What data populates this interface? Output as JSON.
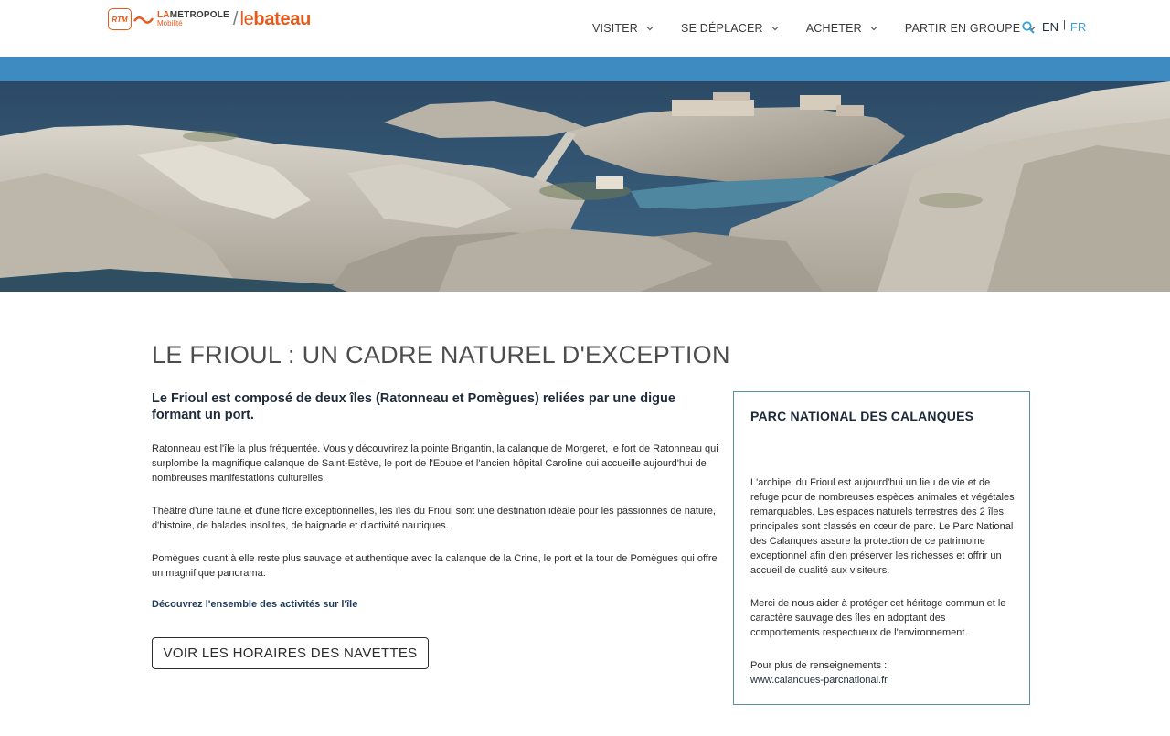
{
  "header": {
    "logo": {
      "rtm_badge": "RTM",
      "metropole_prefix": "LA",
      "metropole_name": "METROPOLE",
      "metropole_sub": "Mobilité",
      "brand_prefix": "le",
      "brand_name": "bateau"
    },
    "nav": [
      {
        "label": "VISITER",
        "icon": "chevron-down-icon"
      },
      {
        "label": "SE DÉPLACER",
        "icon": "chevron-down-icon"
      },
      {
        "label": "ACHETER",
        "icon": "chevron-down-icon"
      },
      {
        "label": "PARTIR EN GROUPE",
        "icon": "chevron-down-icon"
      }
    ],
    "search_icon": "search-icon",
    "lang": {
      "en": "EN",
      "fr": "FR",
      "active": "FR"
    }
  },
  "colors": {
    "brand_orange": "#e85a1b",
    "band_blue": "#3d8bc0",
    "lang_active": "#3a9fd2",
    "heading_dark": "#1e2a3a",
    "box_border": "#5a8fa8"
  },
  "main": {
    "title": "LE FRIOUL : UN CADRE NATUREL D'EXCEPTION",
    "lead": "Le Frioul est composé de deux îles (Ratonneau et Pomègues) reliées par une digue formant un port.",
    "paragraphs": [
      "Ratonneau est l'île la plus fréquentée. Vous y découvrirez la pointe Brigantin, la calanque de Morgeret, le fort de Ratonneau qui surplombe la magnifique calanque de Saint-Estève, le port de l'Eoube et l'ancien hôpital Caroline qui accueille aujourd'hui de nombreuses manifestations culturelles.",
      "Théâtre d'une faune et d'une flore exceptionnelles, les îles du Frioul sont une destination idéale pour les passionnés de nature, d'histoire, de balades insolites, de baignade et d'activité nautiques.",
      "Pomègues quant à elle reste plus sauvage et authentique avec  la calanque de la Crine, le port et la tour de Pomègues qui offre un magnifique panorama."
    ],
    "activities_link": "Découvrez l'ensemble des activités sur l'île",
    "cta_label": "VOIR LES HORAIRES DES NAVETTES"
  },
  "sidebox": {
    "title": "PARC NATIONAL DES CALANQUES",
    "paragraphs": [
      "L'archipel du Frioul est aujourd'hui un lieu de vie et de refuge pour de nombreuses espèces animales et végétales remarquables. Les espaces naturels terrestres des 2  îles principales sont classés en cœur de parc. Le Parc National des Calanques assure la protection de ce patrimoine exceptionnel afin d'en préserver les richesses et offrir un accueil de qualité aux visiteurs.",
      "Merci de nous aider à protéger cet héritage commun et le caractère sauvage des îles en adoptant des comportements respectueux de l'environnement."
    ],
    "info_label": "Pour plus de renseignements :",
    "info_link": "www.calanques-parcnational.fr"
  }
}
